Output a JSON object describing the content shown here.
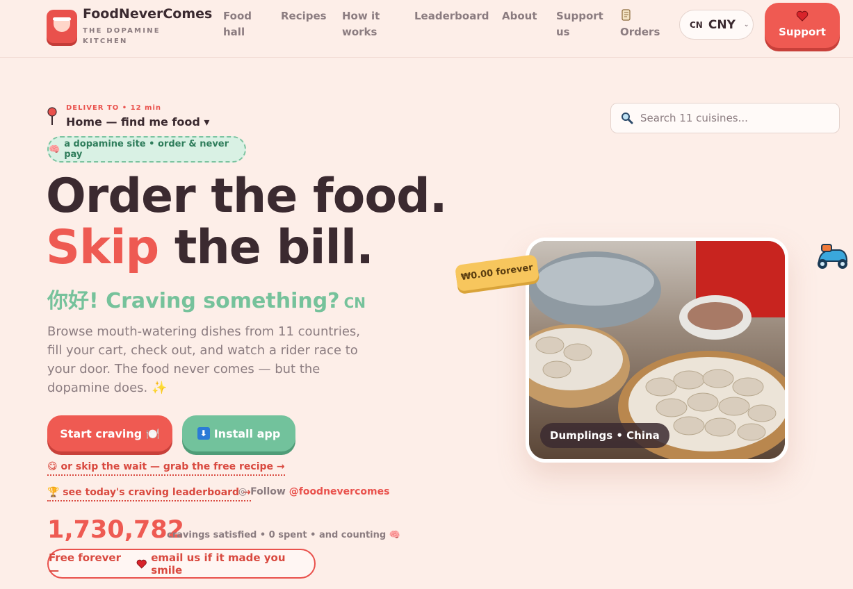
{
  "brand": {
    "name": "FoodNeverComes",
    "tagline": "THE DOPAMINE KITCHEN"
  },
  "nav": {
    "items": [
      {
        "label": "Food hall"
      },
      {
        "label": "Recipes"
      },
      {
        "label": "How it works"
      },
      {
        "label": "Leaderboard"
      },
      {
        "label": "About"
      },
      {
        "label": "Support us"
      },
      {
        "label": "Orders",
        "icon": "scroll-icon"
      }
    ],
    "currency": {
      "flag": "CN",
      "code": "CNY"
    },
    "support_label": "Support"
  },
  "delivery": {
    "label": "DELIVER TO • 12 min",
    "address": "Home — find me food ▾"
  },
  "search": {
    "placeholder": "Search 11 cuisines..."
  },
  "hero": {
    "pill": "a dopamine site • order & never pay",
    "headline_line1": "Order the food.",
    "headline_red": "Skip",
    "headline_rest": " the bill.",
    "greeting": "你好! Craving something?",
    "greeting_flag": "CN",
    "blurb": "Browse mouth-watering dishes from 11 countries, fill your cart, check out, and watch a rider race to your door. The food never comes — but the dopamine does. ✨",
    "start_label": "Start craving 🍽️",
    "install_label": "Install app",
    "recipe_link": "😋 or skip the wait — grab the free recipe →",
    "leaderboard_link": "🏆 see today's craving leaderboard →",
    "follow_prefix": "Follow ",
    "follow_handle": "@foodnevercomes",
    "counter": "1,730,782",
    "counter_caption": "cravings satisfied • 0 spent • and counting 🧠",
    "free_prefix": "Free forever —",
    "free_suffix": "email us if it made you smile"
  },
  "feature": {
    "price_tag": "₩0.00 forever",
    "caption": "Dumplings • China"
  },
  "colors": {
    "accent_red": "#ee5a52",
    "accent_green": "#72c29c",
    "background": "#fdeee8",
    "text_dark": "#3b2a30"
  }
}
